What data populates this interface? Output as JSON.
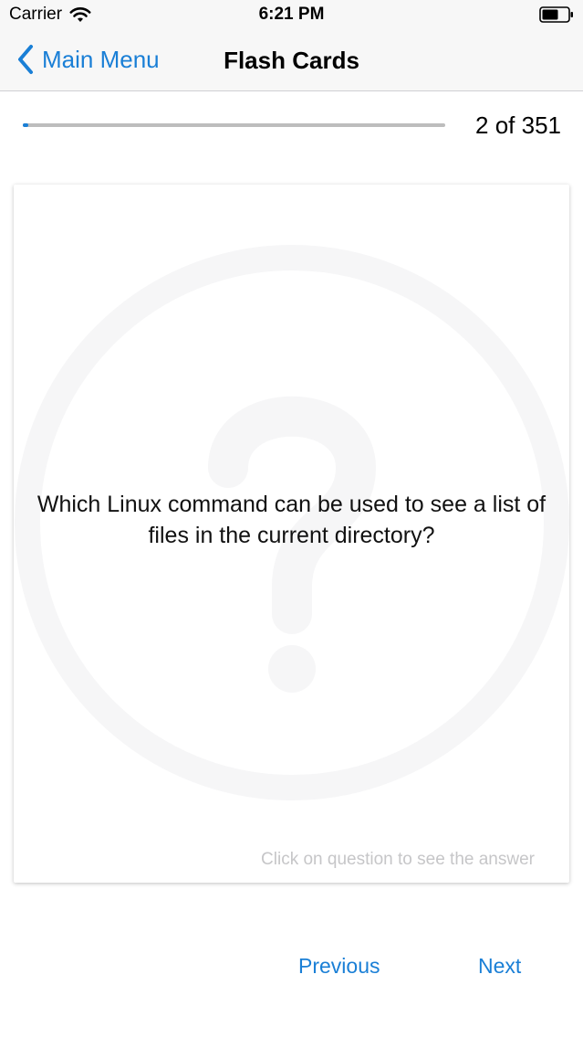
{
  "status_bar": {
    "carrier": "Carrier",
    "time": "6:21 PM"
  },
  "nav_bar": {
    "back_label": "Main Menu",
    "title": "Flash Cards"
  },
  "progress": {
    "current": 2,
    "total": 351,
    "label": "2 of 351",
    "fraction": 0.0057
  },
  "card": {
    "question": "Which Linux command can be used to see a list of files in the current directory?",
    "hint": "Click on question to see the answer",
    "watermark_icon": "question-mark-circle-icon"
  },
  "actions": {
    "previous_label": "Previous",
    "next_label": "Next"
  },
  "colors": {
    "accent": "#1a7fd6",
    "hint_text": "#c6c6c8",
    "bar_background": "#f7f7f7"
  }
}
